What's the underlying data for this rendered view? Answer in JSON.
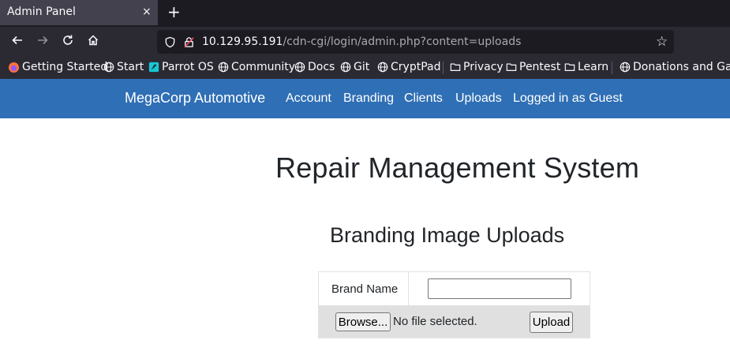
{
  "browser": {
    "tab": {
      "title": "Admin Panel",
      "close_glyph": "×"
    },
    "new_tab_glyph": "+",
    "url": {
      "host": "10.129.95.191",
      "path": "/cdn-cgi/login/admin.php?content=uploads"
    },
    "bookmarks": [
      {
        "label": "Getting Started",
        "icon": "firefox-icon"
      },
      {
        "label": "Start",
        "icon": "globe-icon"
      },
      {
        "label": "Parrot OS",
        "icon": "parrot-icon"
      },
      {
        "label": "Community",
        "icon": "globe-icon"
      },
      {
        "label": "Docs",
        "icon": "globe-icon"
      },
      {
        "label": "Git",
        "icon": "globe-icon"
      },
      {
        "label": "CryptPad",
        "icon": "globe-icon"
      },
      {
        "label": "Privacy",
        "icon": "folder-icon"
      },
      {
        "label": "Pentest",
        "icon": "folder-icon"
      },
      {
        "label": "Learn",
        "icon": "folder-icon"
      },
      {
        "label": "Donations and Gadge",
        "icon": "globe-icon"
      }
    ]
  },
  "site": {
    "brand": "MegaCorp Automotive",
    "nav": [
      "Account",
      "Branding",
      "Clients",
      "Uploads",
      "Logged in as Guest"
    ],
    "accent_color": "#2f6fb5"
  },
  "page": {
    "title": "Repair Management System",
    "section_title": "Branding Image Uploads",
    "form": {
      "brand_name_label": "Brand Name",
      "brand_name_value": "",
      "browse_label": "Browse...",
      "file_status": "No file selected.",
      "upload_label": "Upload"
    }
  }
}
